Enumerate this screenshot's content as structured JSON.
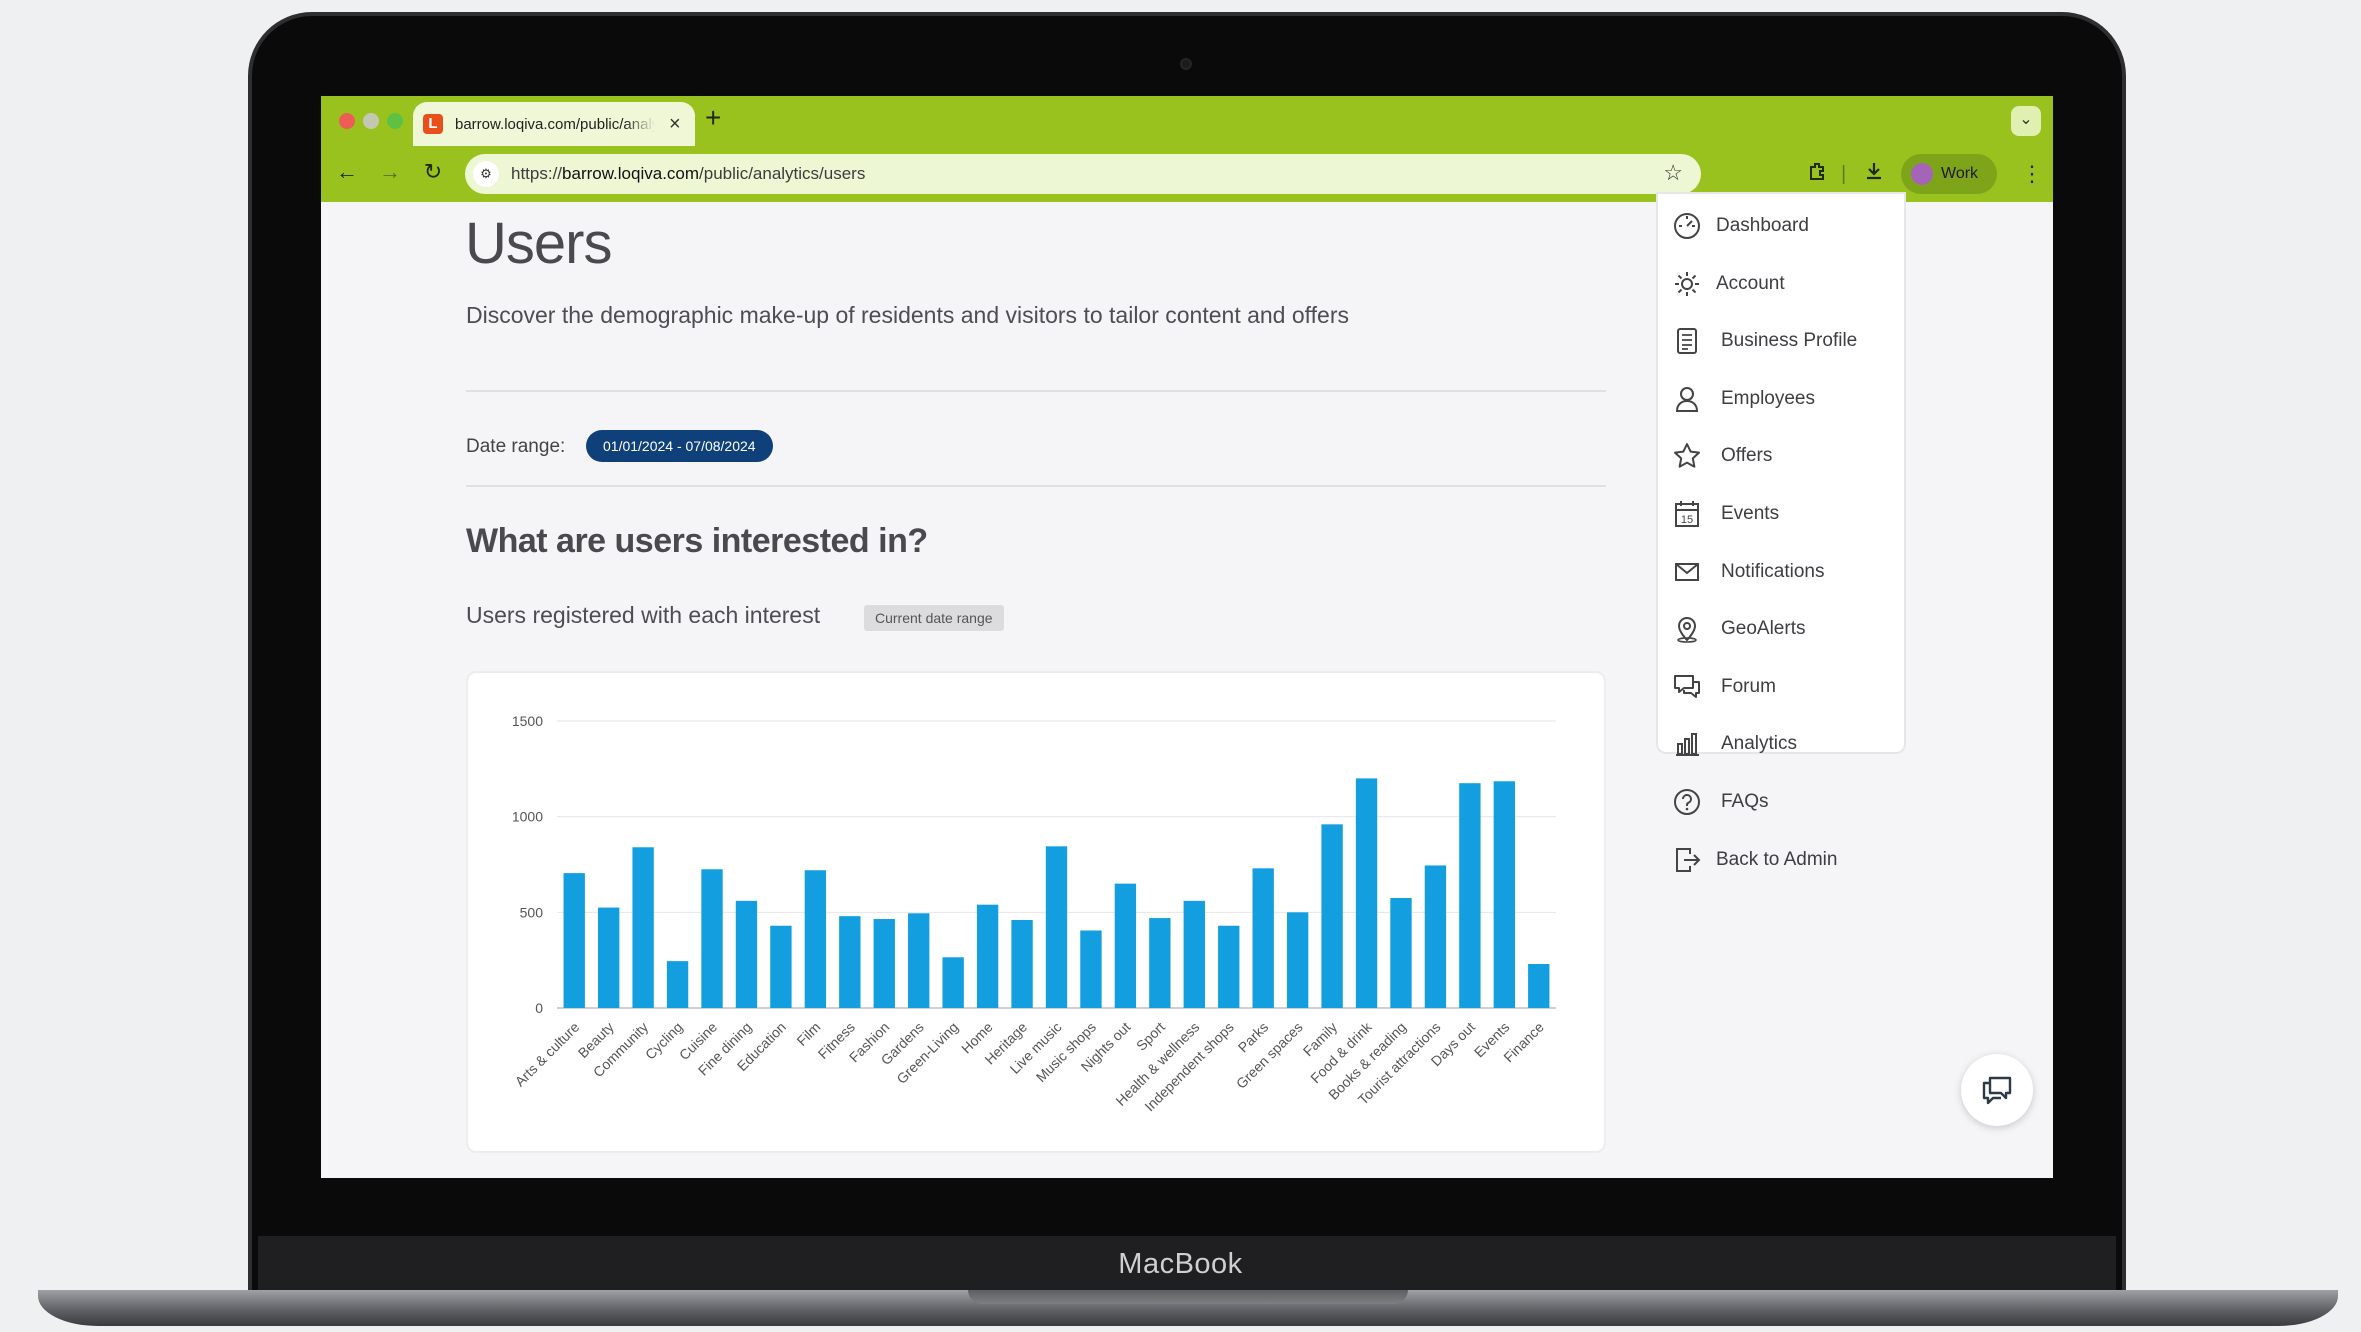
{
  "device": {
    "brand": "MacBook"
  },
  "browser": {
    "tab_title": "barrow.loqiva.com/public/analytics/users",
    "favicon_letter": "L",
    "url_prefix": "https://",
    "url_host": "barrow.loqiva.com",
    "url_path": "/public/analytics/users",
    "profile_label": "Work",
    "accent": "#9ac21f"
  },
  "page": {
    "title": "Users",
    "subtitle": "Discover the demographic make-up of residents and visitors to tailor content and offers",
    "date_range_label": "Date range:",
    "date_range_value": "01/01/2024 - 07/08/2024",
    "section_heading": "What are users interested in?",
    "chart_caption": "Users registered with each interest",
    "chart_badge": "Current date range"
  },
  "menu": {
    "items": [
      {
        "label": "Dashboard",
        "icon": "dashboard-icon"
      },
      {
        "label": "Account",
        "icon": "gear-icon"
      },
      {
        "label": "Business Profile",
        "icon": "profile-card-icon"
      },
      {
        "label": "Employees",
        "icon": "person-icon"
      },
      {
        "label": "Offers",
        "icon": "star-icon"
      },
      {
        "label": "Events",
        "icon": "calendar-icon",
        "icon_text": "15"
      },
      {
        "label": "Notifications",
        "icon": "envelope-icon"
      },
      {
        "label": "GeoAlerts",
        "icon": "map-pin-icon"
      },
      {
        "label": "Forum",
        "icon": "chat-bubbles-icon"
      },
      {
        "label": "Analytics",
        "icon": "bar-chart-icon"
      },
      {
        "label": "FAQs",
        "icon": "question-icon"
      },
      {
        "label": "Back to Admin",
        "icon": "exit-icon"
      }
    ]
  },
  "chart_data": {
    "type": "bar",
    "title": "",
    "xlabel": "",
    "ylabel": "",
    "ylim": [
      0,
      1500
    ],
    "yticks": [
      0,
      500,
      1000,
      1500
    ],
    "grid": true,
    "color": "#139ee0",
    "categories": [
      "Arts & culture",
      "Beauty",
      "Community",
      "Cycling",
      "Cuisine",
      "Fine dining",
      "Education",
      "Film",
      "Fitness",
      "Fashion",
      "Gardens",
      "Green-Living",
      "Home",
      "Heritage",
      "Live music",
      "Music shops",
      "Nights out",
      "Sport",
      "Health & wellness",
      "Independent shops",
      "Parks",
      "Green spaces",
      "Family",
      "Food & drink",
      "Books & reading",
      "Tourist attractions",
      "Days out",
      "Events",
      "Finance"
    ],
    "values": [
      705,
      525,
      840,
      245,
      725,
      560,
      430,
      720,
      480,
      465,
      495,
      265,
      540,
      460,
      845,
      405,
      650,
      470,
      560,
      430,
      730,
      500,
      960,
      1200,
      575,
      745,
      1175,
      1185,
      230
    ]
  }
}
